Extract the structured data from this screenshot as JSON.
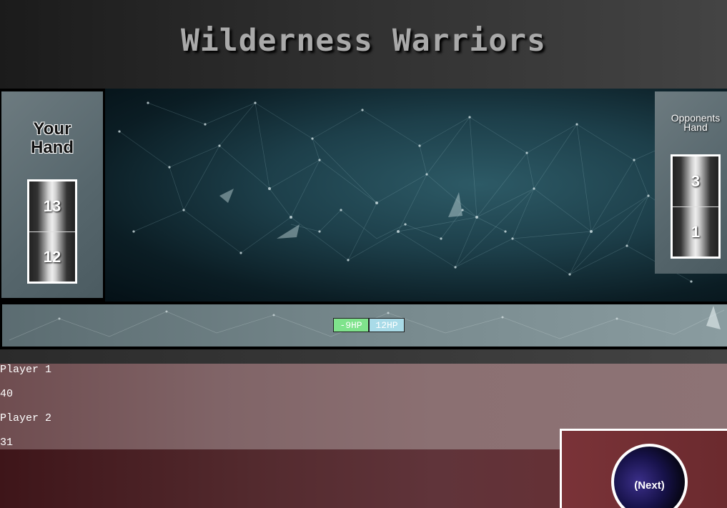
{
  "game": {
    "title": "Wilderness Warriors"
  },
  "player_hand": {
    "title_line1": "Your",
    "title_line2": "Hand",
    "cards": [
      "13",
      "12"
    ]
  },
  "opponent_hand": {
    "title_line1": "Opponents",
    "title_line2": "Hand",
    "cards": [
      "3",
      "1"
    ]
  },
  "battle": {
    "left_hp": "-9HP",
    "right_hp": "12HP"
  },
  "scores": {
    "player1": {
      "name": "Player 1",
      "score": "40"
    },
    "player2": {
      "name": "Player 2",
      "score": "31"
    }
  },
  "controls": {
    "next_label": "(Next)"
  },
  "colors": {
    "hp_left": "#7fe38c",
    "hp_right": "#a9dbe8",
    "next_button": "#17124a"
  }
}
